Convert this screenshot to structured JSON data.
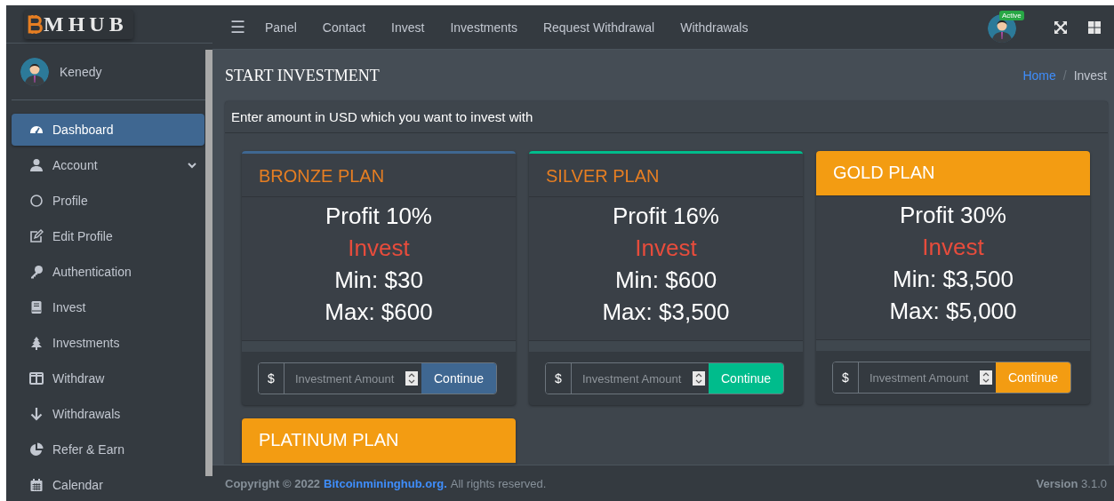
{
  "logo": {
    "text": "MHUB"
  },
  "user": {
    "name": "Kenedy"
  },
  "sidebar": {
    "items": [
      {
        "label": "Dashboard",
        "selected": true
      },
      {
        "label": "Account",
        "selected": false,
        "expanded": true,
        "children": [
          {
            "label": "Profile",
            "selected": false
          },
          {
            "label": "Edit Profile",
            "selected": false
          }
        ]
      },
      {
        "label": "Authentication",
        "selected": false
      },
      {
        "label": "Invest",
        "selected": false
      },
      {
        "label": "Investments",
        "selected": false
      },
      {
        "label": "Withdraw",
        "selected": false
      },
      {
        "label": "Withdrawals",
        "selected": false
      },
      {
        "label": "Refer & Earn",
        "selected": false
      },
      {
        "label": "Calendar",
        "selected": false
      }
    ]
  },
  "topbar": {
    "menu_icon": "☰",
    "links": [
      "Panel",
      "Contact",
      "Invest",
      "Investments",
      "Request Withdrawal",
      "Withdrawals"
    ],
    "status_badge": "Active"
  },
  "page": {
    "title": "START INVESTMENT",
    "breadcrumb_separator": "/",
    "breadcrumb": [
      {
        "label": "Home",
        "link": true
      },
      {
        "label": "Invest",
        "link": false
      }
    ]
  },
  "card": {
    "title": "Enter amount in USD which you want to invest with"
  },
  "plans": [
    {
      "name": "BRONZE PLAN",
      "kind": "outline",
      "color": "#3f6791",
      "profit": "Profit 10%",
      "invest": "Invest",
      "min": "Min:  $30",
      "max": "Max:  $600",
      "currency": "$",
      "placeholder": "Investment Amount",
      "button": "Continue"
    },
    {
      "name": "SILVER PLAN",
      "kind": "outline",
      "color": "#00bc8c",
      "profit": "Profit 16%",
      "invest": "Invest",
      "min": "Min:  $600",
      "max": "Max:  $3,500",
      "currency": "$",
      "placeholder": "Investment Amount",
      "button": "Continue"
    },
    {
      "name": "GOLD PLAN",
      "kind": "filled",
      "color": "#f39c12",
      "profit": "Profit 30%",
      "invest": "Invest",
      "min": "Min:  $3,500",
      "max": "Max:  $5,000",
      "currency": "$",
      "placeholder": "Investment Amount",
      "button": "Continue"
    },
    {
      "name": "PLATINUM PLAN",
      "kind": "filled",
      "color": "#f39c12"
    }
  ],
  "footer": {
    "copyright": "Copyright © 2022",
    "link": "Bitcoinmininghub.org.",
    "rights": "All rights reserved.",
    "version": "**Version** 3.1.0"
  }
}
